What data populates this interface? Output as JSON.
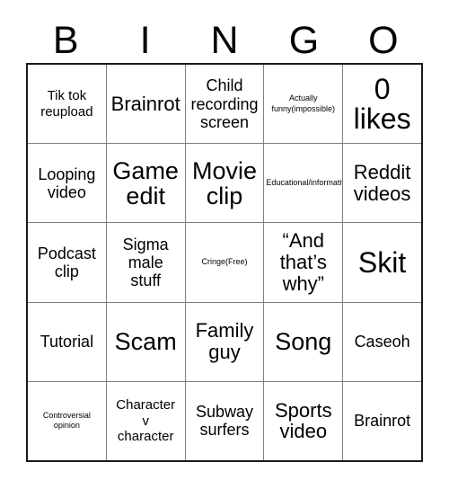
{
  "card": {
    "title_letters": [
      "B",
      "I",
      "N",
      "G",
      "O"
    ],
    "columns": [
      "B",
      "I",
      "N",
      "G",
      "O"
    ],
    "rows": [
      [
        {
          "text": "Tik tok\nreupload",
          "size": "fs-s"
        },
        {
          "text": "Brainrot",
          "size": "fs-l"
        },
        {
          "text": "Child\nrecording\nscreen",
          "size": "fs-m"
        },
        {
          "text": "Actually\nfunny(impossible)",
          "size": "fs-xs"
        },
        {
          "text": "0\nlikes",
          "size": "fs-xxl"
        }
      ],
      [
        {
          "text": "Looping\nvideo",
          "size": "fs-m"
        },
        {
          "text": "Game\nedit",
          "size": "fs-xl"
        },
        {
          "text": "Movie\nclip",
          "size": "fs-xl"
        },
        {
          "text": "Educational/informative",
          "size": "fs-xs"
        },
        {
          "text": "Reddit\nvideos",
          "size": "fs-l"
        }
      ],
      [
        {
          "text": "Podcast\nclip",
          "size": "fs-m"
        },
        {
          "text": "Sigma\nmale\nstuff",
          "size": "fs-m"
        },
        {
          "text": "Cringe(Free)",
          "size": "fs-xs"
        },
        {
          "text": "“And\nthat’s\nwhy”",
          "size": "fs-l"
        },
        {
          "text": "Skit",
          "size": "fs-xxl"
        }
      ],
      [
        {
          "text": "Tutorial",
          "size": "fs-m"
        },
        {
          "text": "Scam",
          "size": "fs-xl"
        },
        {
          "text": "Family\nguy",
          "size": "fs-l"
        },
        {
          "text": "Song",
          "size": "fs-xl"
        },
        {
          "text": "Caseoh",
          "size": "fs-m"
        }
      ],
      [
        {
          "text": "Controversial\nopinion",
          "size": "fs-xs"
        },
        {
          "text": "Character\nv\ncharacter",
          "size": "fs-s"
        },
        {
          "text": "Subway\nsurfers",
          "size": "fs-m"
        },
        {
          "text": "Sports\nvideo",
          "size": "fs-l"
        },
        {
          "text": "Brainrot",
          "size": "fs-m"
        }
      ]
    ],
    "free_space": {
      "row": 2,
      "column": 2,
      "label": "Cringe(Free)"
    },
    "colors": {
      "text": "#000000",
      "background": "#ffffff",
      "outer_border": "#1a1a1a",
      "inner_border": "#808080"
    }
  }
}
